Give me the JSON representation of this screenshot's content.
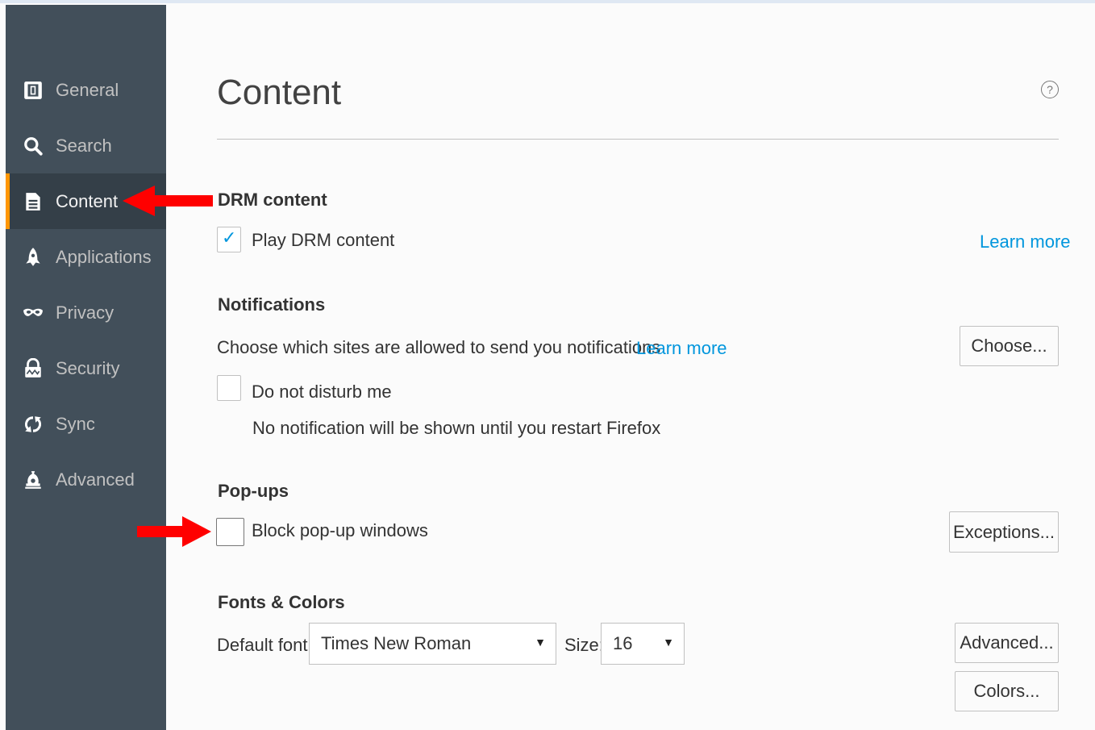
{
  "sidebar": {
    "items": [
      {
        "label": "General",
        "icon": "general-icon"
      },
      {
        "label": "Search",
        "icon": "search-icon"
      },
      {
        "label": "Content",
        "icon": "content-icon",
        "selected": true
      },
      {
        "label": "Applications",
        "icon": "applications-icon"
      },
      {
        "label": "Privacy",
        "icon": "privacy-icon"
      },
      {
        "label": "Security",
        "icon": "security-icon"
      },
      {
        "label": "Sync",
        "icon": "sync-icon"
      },
      {
        "label": "Advanced",
        "icon": "advanced-icon"
      }
    ]
  },
  "page": {
    "title": "Content",
    "help": "?"
  },
  "drm": {
    "heading": "DRM content",
    "checkbox_label": "Play DRM content",
    "checked": true,
    "learn_more": "Learn more"
  },
  "notifications": {
    "heading": "Notifications",
    "description": "Choose which sites are allowed to send you notifications",
    "learn_more": "Learn more",
    "choose_button": "Choose...",
    "dnd_label": "Do not disturb me",
    "dnd_checked": false,
    "dnd_note": "No notification will be shown until you restart Firefox"
  },
  "popups": {
    "heading": "Pop-ups",
    "checkbox_label": "Block pop-up windows",
    "checked": false,
    "exceptions_button": "Exceptions..."
  },
  "fonts": {
    "heading": "Fonts & Colors",
    "default_font_label": "Default font:",
    "default_font_value": "Times New Roman",
    "size_label": "Size:",
    "size_value": "16",
    "advanced_button": "Advanced...",
    "colors_button": "Colors..."
  },
  "colors": {
    "sidebar_bg": "#424f5a",
    "accent": "#ff9500",
    "link": "#0096dd",
    "annotation_arrow": "#ff0000"
  }
}
